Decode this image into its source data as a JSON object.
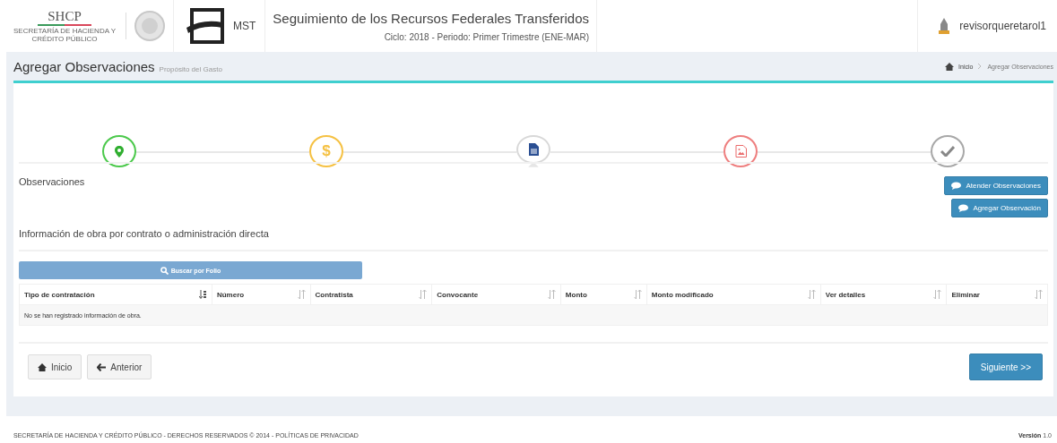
{
  "header": {
    "logo_text": "SHCP",
    "logo_subtext": "SECRETARÍA DE HACIENDA Y CRÉDITO PÚBLICO",
    "app_logo_text": "MST",
    "title": "Seguimiento de los Recursos Federales Transferidos",
    "subtitle": "Ciclo: 2018 - Periodo: Primer Trimestre (ENE-MAR)",
    "user": "revisorqueretarol1"
  },
  "page": {
    "title": "Agregar Observaciones",
    "subtitle": "Propósito del Gasto",
    "breadcrumb": [
      "Inicio",
      "Agregar Observaciones"
    ]
  },
  "steps": [
    {
      "kind": "pin",
      "color": "#4cc94c",
      "selected": false
    },
    {
      "kind": "glyph",
      "glyph": "$",
      "color": "#f5c143",
      "selected": false
    },
    {
      "kind": "document",
      "color": "#d8d8d8",
      "selected": true
    },
    {
      "kind": "image",
      "color": "#ee7f7f",
      "selected": false
    },
    {
      "kind": "check",
      "color": "#a8a8a8",
      "selected": false
    }
  ],
  "observations": {
    "heading": "Observaciones",
    "buttons": [
      "Atender Observaciones",
      "Agregar Observación"
    ]
  },
  "works": {
    "heading": "Información de obra por contrato o administración directa",
    "search_button": "Buscar por Folio",
    "table": {
      "columns": [
        {
          "label": "Tipo de contratación",
          "sorted": true
        },
        {
          "label": "Número",
          "sorted": false
        },
        {
          "label": "Contratista",
          "sorted": false
        },
        {
          "label": "Convocante",
          "sorted": false
        },
        {
          "label": "Monto",
          "sorted": false
        },
        {
          "label": "Monto modificado",
          "sorted": false
        },
        {
          "label": "Ver detalles",
          "sorted": false
        },
        {
          "label": "Eliminar",
          "sorted": false
        }
      ],
      "empty_message": "No se han registrado información de obra."
    }
  },
  "nav_buttons": {
    "home": "Inicio",
    "back": "Anterior",
    "next": "Siguiente >>"
  },
  "footer": {
    "left": "SECRETARÍA DE HACIENDA Y CRÉDITO PÚBLICO - DERECHOS RESERVADOS © 2014 - POLÍTICAS DE PRIVACIDAD",
    "version_label": "Versión",
    "version": "1.0"
  }
}
